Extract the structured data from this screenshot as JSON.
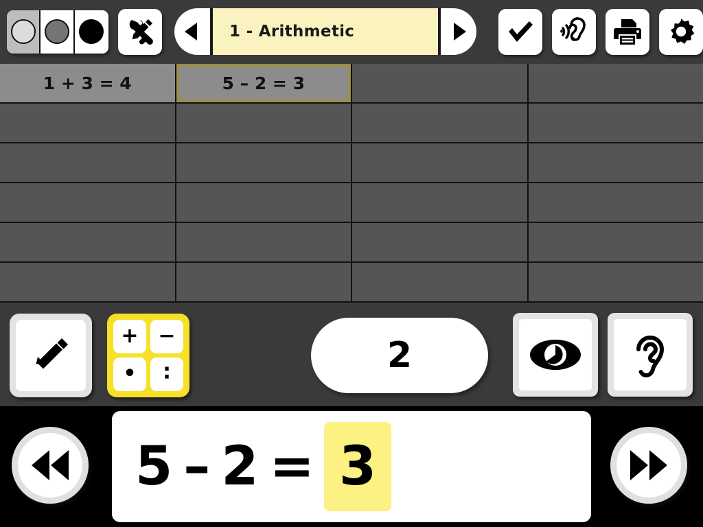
{
  "app": {
    "title": "1 - Arithmetic"
  },
  "colors": {
    "background": "#3a3a3a",
    "grid_cell": "#555555",
    "grid_cell_filled": "#8c8c8c",
    "selection_border": "#9c8f4c",
    "title_bg": "#faf3c0",
    "operator_pad": "#f7e028",
    "answer_highlight": "#fcf284",
    "bottom_bar": "#000000"
  },
  "topbar": {
    "contrast_modes": [
      {
        "name": "contrast-light",
        "label": "",
        "icon": "circle-light-icon",
        "selected": true
      },
      {
        "name": "contrast-medium",
        "label": "",
        "icon": "circle-gray-icon",
        "selected": false
      },
      {
        "name": "contrast-dark",
        "label": "",
        "icon": "circle-black-icon",
        "selected": false
      }
    ],
    "tools_icon": "wrench-pencil-icon",
    "prev_icon": "triangle-left-icon",
    "next_icon": "triangle-right-icon",
    "actions": [
      {
        "name": "check-button",
        "icon": "check-icon"
      },
      {
        "name": "listen-button",
        "icon": "ear-sound-icon"
      },
      {
        "name": "print-button",
        "icon": "printer-icon"
      },
      {
        "name": "settings-button",
        "icon": "gear-icon"
      }
    ]
  },
  "grid": {
    "columns": 4,
    "rows": 6,
    "cells": [
      {
        "text": "1 + 3 = 4",
        "filled": true,
        "selected": false
      },
      {
        "text": "5 – 2 = 3",
        "filled": true,
        "selected": true
      },
      {
        "text": "",
        "filled": false,
        "selected": false
      },
      {
        "text": "",
        "filled": false,
        "selected": false
      },
      {
        "text": "",
        "filled": false,
        "selected": false
      },
      {
        "text": "",
        "filled": false,
        "selected": false
      },
      {
        "text": "",
        "filled": false,
        "selected": false
      },
      {
        "text": "",
        "filled": false,
        "selected": false
      },
      {
        "text": "",
        "filled": false,
        "selected": false
      },
      {
        "text": "",
        "filled": false,
        "selected": false
      },
      {
        "text": "",
        "filled": false,
        "selected": false
      },
      {
        "text": "",
        "filled": false,
        "selected": false
      },
      {
        "text": "",
        "filled": false,
        "selected": false
      },
      {
        "text": "",
        "filled": false,
        "selected": false
      },
      {
        "text": "",
        "filled": false,
        "selected": false
      },
      {
        "text": "",
        "filled": false,
        "selected": false
      },
      {
        "text": "",
        "filled": false,
        "selected": false
      },
      {
        "text": "",
        "filled": false,
        "selected": false
      },
      {
        "text": "",
        "filled": false,
        "selected": false
      },
      {
        "text": "",
        "filled": false,
        "selected": false
      },
      {
        "text": "",
        "filled": false,
        "selected": false
      },
      {
        "text": "",
        "filled": false,
        "selected": false
      },
      {
        "text": "",
        "filled": false,
        "selected": false
      },
      {
        "text": "",
        "filled": false,
        "selected": false
      }
    ]
  },
  "midbar": {
    "pencil_icon": "pencil-icon",
    "operators": [
      {
        "name": "operator-plus",
        "symbol": "+"
      },
      {
        "name": "operator-minus",
        "symbol": "−"
      },
      {
        "name": "operator-multiply",
        "symbol": "•"
      },
      {
        "name": "operator-divide",
        "symbol": "∶"
      }
    ],
    "counter_value": "2",
    "eye_icon": "eye-icon",
    "ear_icon": "ear-icon"
  },
  "bottombar": {
    "prev_icon": "rewind-icon",
    "next_icon": "fast-forward-icon",
    "equation": {
      "operand_a": "5",
      "operator": "–",
      "operand_b": "2",
      "equals": "=",
      "answer": "3"
    }
  }
}
